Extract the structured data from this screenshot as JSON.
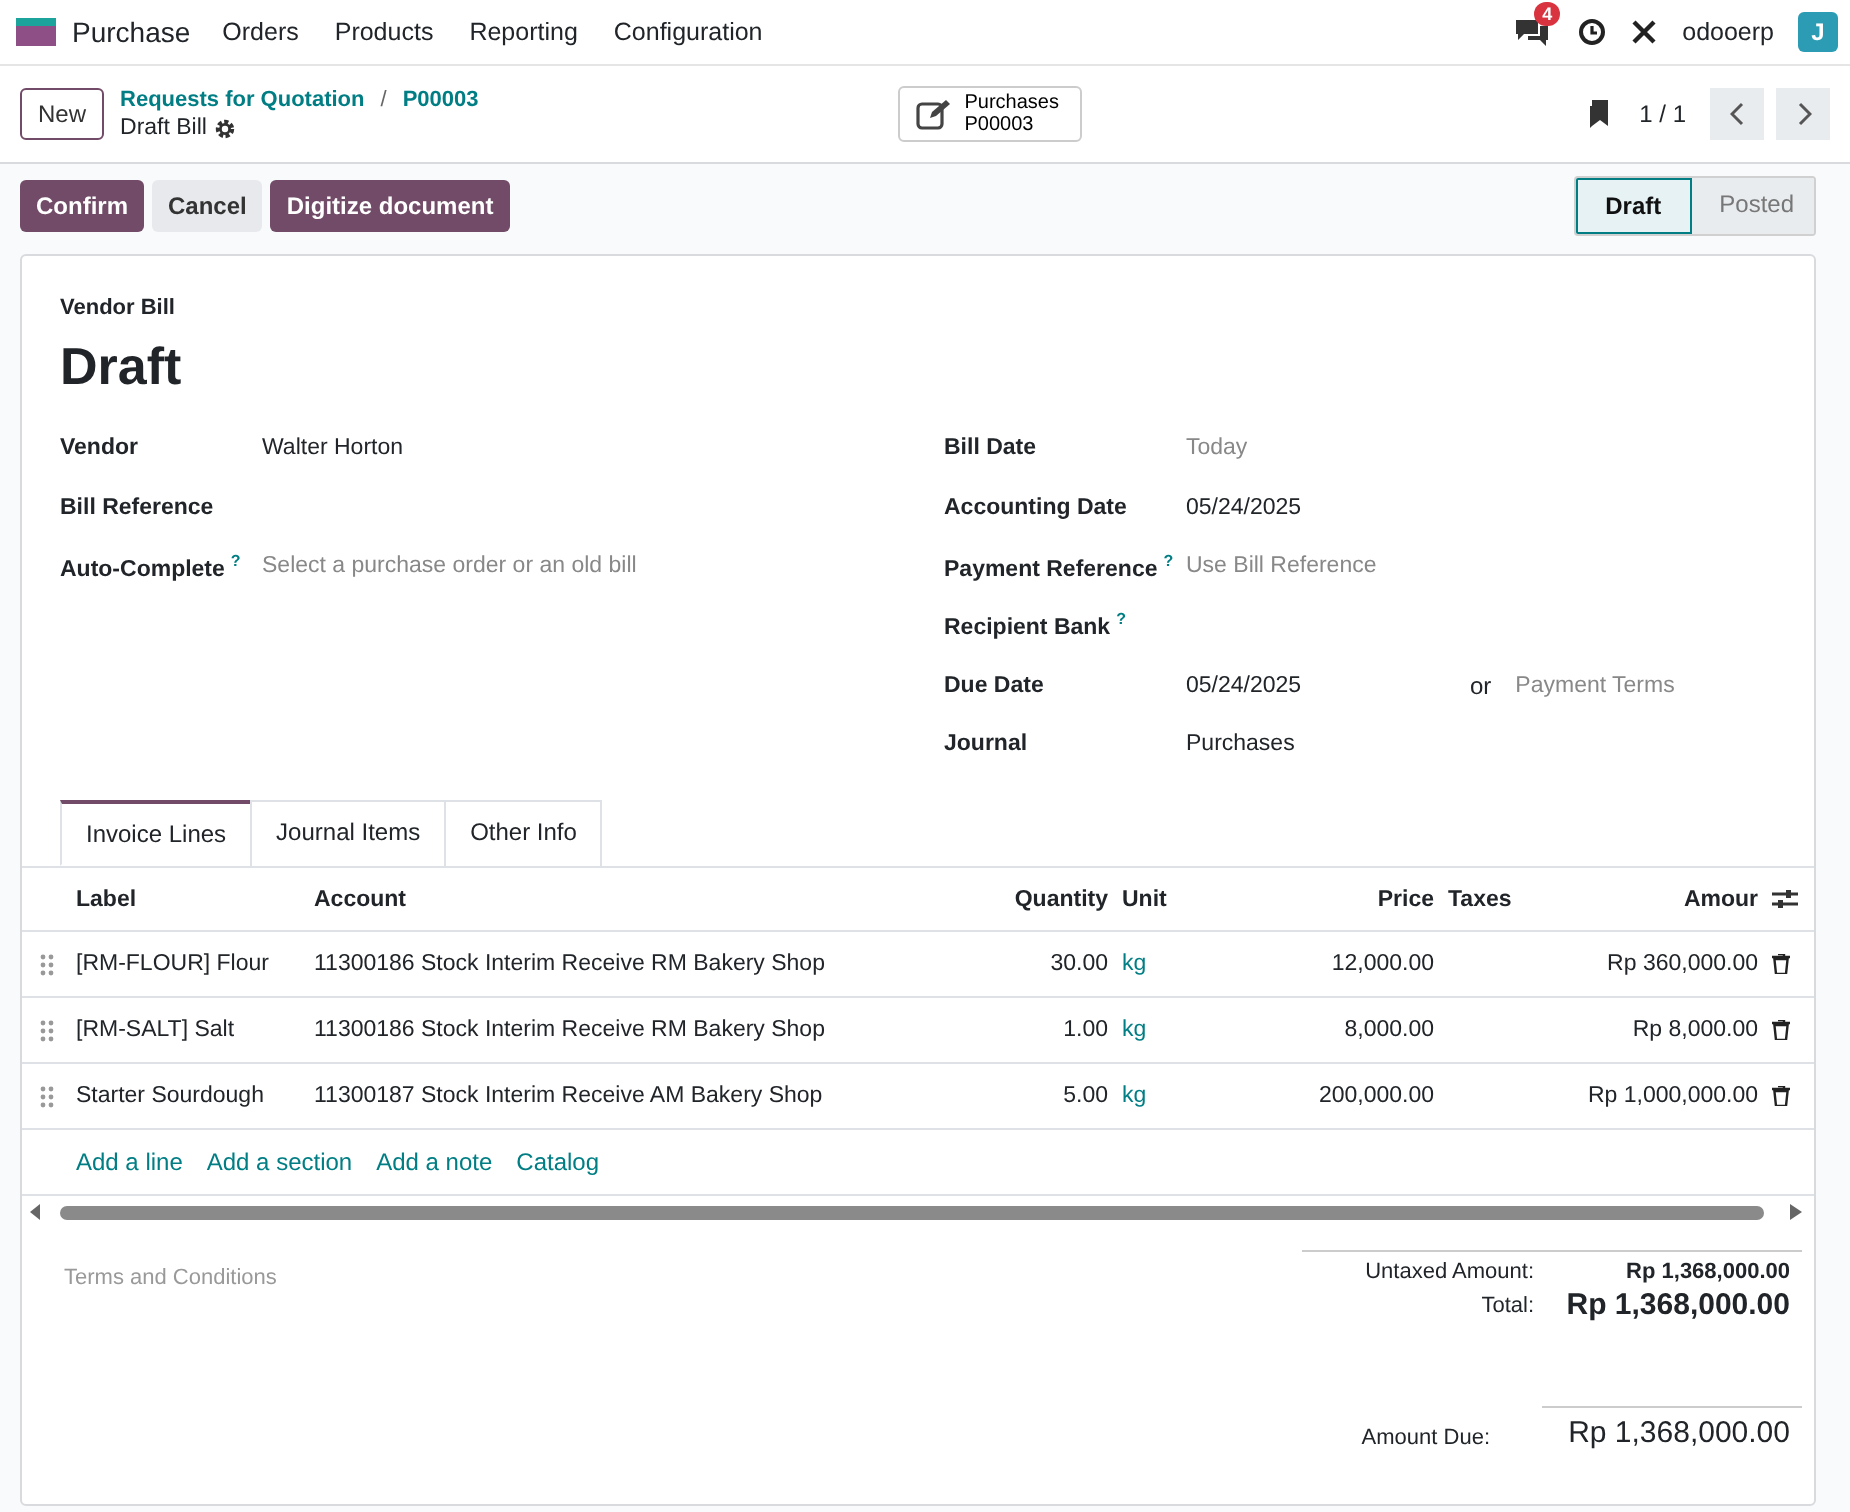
{
  "navbar": {
    "app_name": "Purchase",
    "menu": [
      "Orders",
      "Products",
      "Reporting",
      "Configuration"
    ],
    "chat_badge": "4",
    "user": "odooerp",
    "avatar": "J"
  },
  "control_panel": {
    "new_button": "New",
    "breadcrumbs": [
      "Requests for Quotation",
      "P00003"
    ],
    "breadcrumb_separator": "/",
    "record": "Draft Bill",
    "smart_button": {
      "label": "Purchases",
      "value": "P00003"
    },
    "pager": "1 / 1"
  },
  "actions": [
    {
      "label": "Confirm",
      "kind": "primary"
    },
    {
      "label": "Cancel",
      "kind": "secondary"
    },
    {
      "label": "Digitize document",
      "kind": "primary"
    }
  ],
  "statusbar": [
    {
      "label": "Draft",
      "selected": true
    },
    {
      "label": "Posted",
      "selected": false
    }
  ],
  "form": {
    "doc_type": "Vendor Bill",
    "title": "Draft",
    "left_fields": [
      {
        "label": "Vendor",
        "value": "Walter Horton"
      },
      {
        "label": "Bill Reference"
      },
      {
        "label": "Auto-Complete",
        "help": "?",
        "placeholder": "Select a purchase order or an old bill"
      }
    ],
    "right_fields": [
      {
        "label": "Bill Date",
        "placeholder": "Today"
      },
      {
        "label": "Accounting Date",
        "value": "05/24/2025"
      },
      {
        "label": "Payment Reference",
        "help": "?",
        "placeholder": "Use Bill Reference"
      },
      {
        "label": "Recipient Bank",
        "help": "?"
      },
      {
        "label": "Due Date",
        "value": "05/24/2025",
        "connector": "or",
        "extra_placeholder": "Payment Terms"
      },
      {
        "label": "Journal",
        "value": "Purchases"
      }
    ]
  },
  "tabs": [
    {
      "label": "Invoice Lines",
      "selected": true
    },
    {
      "label": "Journal Items",
      "selected": false
    },
    {
      "label": "Other Info",
      "selected": false
    }
  ],
  "table": {
    "columns": [
      "Label",
      "Account",
      "Quantity",
      "Unit",
      "Price",
      "Taxes",
      "Amour"
    ],
    "rows": [
      {
        "label": "[RM-FLOUR] Flour",
        "account": "11300186 Stock Interim Receive RM Bakery Shop",
        "quantity": "30.00",
        "unit": "kg",
        "price": "12,000.00",
        "amount": "Rp 360,000.00"
      },
      {
        "label": "[RM-SALT] Salt",
        "account": "11300186 Stock Interim Receive RM Bakery Shop",
        "quantity": "1.00",
        "unit": "kg",
        "price": "8,000.00",
        "amount": "Rp 8,000.00"
      },
      {
        "label": "Starter Sourdough",
        "account": "11300187 Stock Interim Receive AM Bakery Shop",
        "quantity": "5.00",
        "unit": "kg",
        "price": "200,000.00",
        "amount": "Rp 1,000,000.00"
      }
    ],
    "add_links": [
      "Add a line",
      "Add a section",
      "Add a note",
      "Catalog"
    ]
  },
  "terms_placeholder": "Terms and Conditions",
  "totals": {
    "untaxed_label": "Untaxed Amount:",
    "untaxed": "Rp 1,368,000.00",
    "total_label": "Total:",
    "total": "Rp 1,368,000.00",
    "due_label": "Amount Due:",
    "due": "Rp 1,368,000.00"
  }
}
